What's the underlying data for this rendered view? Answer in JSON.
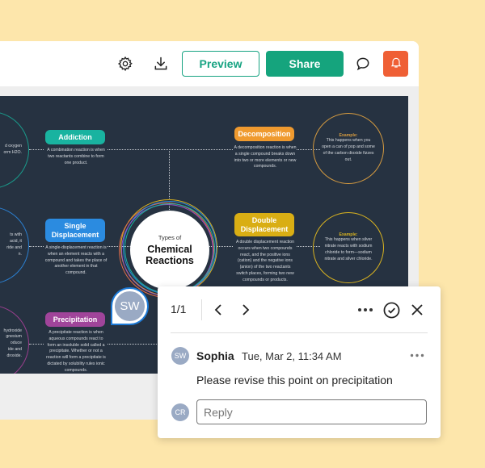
{
  "toolbar": {
    "settings_icon": "gear-icon",
    "download_icon": "download-icon",
    "preview_label": "Preview",
    "share_label": "Share",
    "comment_icon": "speech-bubble-icon",
    "notifications_icon": "bell-icon"
  },
  "colors": {
    "background": "#fde6ab",
    "primary_green": "#15a47d",
    "alert_orange": "#ef5f35",
    "canvas_dark": "#263241",
    "avatar_gray": "#9aaac4"
  },
  "mindmap": {
    "center": {
      "small": "Types of",
      "line1": "Chemical",
      "line2": "Reactions"
    },
    "left_examples": [
      {
        "lines": [
          "d oxygen",
          "orm H2O."
        ],
        "color": "#1a9c8c"
      },
      {
        "lines": [
          "ts with",
          "acid, it",
          "ride and",
          "n."
        ],
        "color": "#2b7fd0"
      },
      {
        "lines": [
          "hydroxide",
          "gnesium",
          "oduce",
          "ide and",
          "droxide."
        ],
        "color": "#9a3f8e"
      }
    ],
    "nodes": [
      {
        "title": "Addiction",
        "color": "#19b3a0",
        "description": "A combination reaction is when two reactants combine to form one product."
      },
      {
        "title": "Single Displacement",
        "color": "#2b8be0",
        "description": "A single-displacement reaction is when an element reacts with a compound and takes the place of another element in that compound."
      },
      {
        "title": "Precipitation",
        "color": "#a0449a",
        "description": "A precipitate reaction is when aqueous compounds react to form an insoluble solid called a precipitate. Whether or not a reaction will form a precipitate is dictated by solubility rules ionic compounds."
      },
      {
        "title": "Decomposition",
        "color": "#ef9a2f",
        "description": "A decomposition reaction is when a single compound breaks down into two or more elements or new compounds."
      },
      {
        "title": "Double Displacement",
        "color": "#d9ae14",
        "description": "A double displacement reaction occurs when two compounds react, and the positive ions (cation) and the negative ions (anion) of the two reactants switch places, forming two new compounds or products."
      }
    ],
    "right_examples": [
      {
        "title": "Example:",
        "body": "This happens when you open a can of pop and some of the carbon dioxide fizzes out.",
        "color": "#d49a40"
      },
      {
        "title": "Example:",
        "body": "This happens when silver nitrate reacts with sodium chloride to form—sodium nitrate and silver chloride.",
        "color": "#d9b320"
      }
    ],
    "marker_initials": "SW"
  },
  "comment_popup": {
    "pager": "1/1",
    "prev_icon": "chevron-left-icon",
    "next_icon": "chevron-right-icon",
    "more_icon": "ellipsis-icon",
    "resolve_icon": "check-circle-icon",
    "close_icon": "close-icon",
    "comment": {
      "avatar_initials": "SW",
      "author": "Sophia",
      "timestamp": "Tue, Mar 2, 11:34 AM",
      "text": "Please revise this point on precipitation"
    },
    "reply": {
      "avatar_initials": "CR",
      "placeholder": "Reply",
      "value": ""
    }
  }
}
